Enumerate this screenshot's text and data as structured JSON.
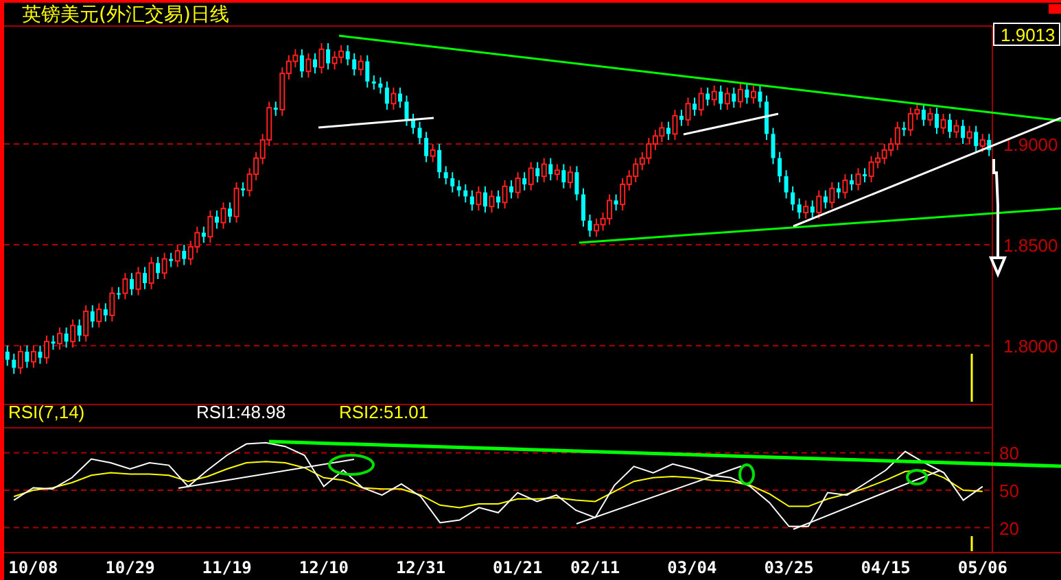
{
  "title": "英镑美元(外汇交易)日线",
  "price_chart": {
    "current": "1.9013",
    "chart_data": {
      "type": "candlestick",
      "grid": true,
      "ylim": [
        1.7708,
        1.9585
      ],
      "categories": [
        null,
        null,
        null,
        null,
        null,
        null,
        null,
        null,
        null,
        null,
        null,
        null,
        null,
        null,
        null,
        null,
        null,
        null,
        null,
        null,
        null,
        null,
        null,
        null,
        null,
        null,
        null,
        null,
        null,
        null,
        null,
        null,
        null,
        null,
        null,
        null,
        null,
        null,
        null,
        null,
        null,
        null,
        null,
        null,
        null,
        null,
        null,
        null,
        null,
        null,
        null,
        null,
        null,
        null,
        null,
        null,
        null,
        null,
        null,
        null,
        null,
        null,
        null,
        null,
        null,
        null,
        null,
        null,
        null,
        null,
        null,
        null,
        null,
        null,
        null,
        null,
        null,
        null,
        null,
        null,
        null,
        null,
        null,
        null,
        null,
        null,
        null,
        null,
        null,
        null,
        null,
        null,
        null,
        null,
        null,
        null,
        null,
        null,
        null,
        null,
        null,
        null,
        null,
        null,
        null,
        null,
        null,
        null,
        null,
        null,
        null,
        null,
        null,
        null,
        null,
        null,
        null,
        null,
        null,
        null,
        null,
        null,
        null,
        null,
        null,
        null,
        null,
        null,
        null,
        null,
        null,
        null,
        null,
        null,
        null,
        null,
        null,
        null,
        null,
        null,
        null,
        null,
        null,
        null,
        null,
        null,
        null,
        null,
        null,
        null,
        null
      ],
      "yticks": [
        {
          "value": 1.9,
          "label": "1.9000"
        },
        {
          "value": 1.85,
          "label": "1.8500"
        },
        {
          "value": 1.8,
          "label": "1.8000"
        }
      ],
      "ohlc": [
        [
          1.797,
          1.8,
          1.79,
          1.793
        ],
        [
          1.793,
          1.796,
          1.786,
          1.789
        ],
        [
          1.789,
          1.8,
          1.786,
          1.797
        ],
        [
          1.797,
          1.8,
          1.789,
          1.792
        ],
        [
          1.792,
          1.8,
          1.789,
          1.797
        ],
        [
          1.797,
          1.8,
          1.791,
          1.794
        ],
        [
          1.794,
          1.805,
          1.791,
          1.802
        ],
        [
          1.802,
          1.805,
          1.798,
          1.801
        ],
        [
          1.801,
          1.809,
          1.798,
          1.806
        ],
        [
          1.806,
          1.809,
          1.799,
          1.802
        ],
        [
          1.802,
          1.813,
          1.799,
          1.81
        ],
        [
          1.81,
          1.813,
          1.802,
          1.805
        ],
        [
          1.805,
          1.82,
          1.802,
          1.817
        ],
        [
          1.817,
          1.82,
          1.809,
          1.812
        ],
        [
          1.812,
          1.821,
          1.809,
          1.818
        ],
        [
          1.818,
          1.821,
          1.812,
          1.815
        ],
        [
          1.815,
          1.829,
          1.812,
          1.826
        ],
        [
          1.826,
          1.829,
          1.823,
          1.826
        ],
        [
          1.826,
          1.836,
          1.823,
          1.833
        ],
        [
          1.833,
          1.836,
          1.825,
          1.828
        ],
        [
          1.828,
          1.839,
          1.825,
          1.836
        ],
        [
          1.836,
          1.839,
          1.828,
          1.831
        ],
        [
          1.831,
          1.844,
          1.828,
          1.841
        ],
        [
          1.841,
          1.844,
          1.833,
          1.836
        ],
        [
          1.836,
          1.846,
          1.833,
          1.843
        ],
        [
          1.843,
          1.846,
          1.839,
          1.842
        ],
        [
          1.842,
          1.85,
          1.839,
          1.847
        ],
        [
          1.847,
          1.85,
          1.84,
          1.843
        ],
        [
          1.843,
          1.852,
          1.84,
          1.849
        ],
        [
          1.849,
          1.859,
          1.846,
          1.856
        ],
        [
          1.856,
          1.859,
          1.851,
          1.854
        ],
        [
          1.854,
          1.867,
          1.851,
          1.864
        ],
        [
          1.864,
          1.867,
          1.858,
          1.861
        ],
        [
          1.861,
          1.871,
          1.858,
          1.868
        ],
        [
          1.868,
          1.871,
          1.861,
          1.864
        ],
        [
          1.864,
          1.881,
          1.861,
          1.878
        ],
        [
          1.878,
          1.881,
          1.874,
          1.877
        ],
        [
          1.877,
          1.888,
          1.874,
          1.885
        ],
        [
          1.885,
          1.896,
          1.882,
          1.893
        ],
        [
          1.893,
          1.905,
          1.89,
          1.902
        ],
        [
          1.902,
          1.921,
          1.899,
          1.918
        ],
        [
          1.918,
          1.921,
          1.914,
          1.917
        ],
        [
          1.917,
          1.938,
          1.914,
          1.935
        ],
        [
          1.935,
          1.944,
          1.932,
          1.941
        ],
        [
          1.941,
          1.947,
          1.938,
          1.944
        ],
        [
          1.944,
          1.947,
          1.933,
          1.936
        ],
        [
          1.936,
          1.945,
          1.933,
          1.942
        ],
        [
          1.942,
          1.945,
          1.935,
          1.938
        ],
        [
          1.938,
          1.95,
          1.935,
          1.947
        ],
        [
          1.947,
          1.95,
          1.937,
          1.94
        ],
        [
          1.94,
          1.946,
          1.937,
          1.943
        ],
        [
          1.943,
          1.949,
          1.94,
          1.946
        ],
        [
          1.946,
          1.949,
          1.939,
          1.942
        ],
        [
          1.942,
          1.945,
          1.934,
          1.937
        ],
        [
          1.937,
          1.944,
          1.934,
          1.941
        ],
        [
          1.941,
          1.944,
          1.928,
          1.931
        ],
        [
          1.931,
          1.934,
          1.927,
          1.93
        ],
        [
          1.93,
          1.933,
          1.925,
          1.928
        ],
        [
          1.928,
          1.931,
          1.917,
          1.92
        ],
        [
          1.92,
          1.928,
          1.917,
          1.925
        ],
        [
          1.925,
          1.928,
          1.918,
          1.921
        ],
        [
          1.921,
          1.924,
          1.909,
          1.912
        ],
        [
          1.912,
          1.915,
          1.905,
          1.908
        ],
        [
          1.908,
          1.911,
          1.9,
          1.903
        ],
        [
          1.903,
          1.906,
          1.891,
          1.894
        ],
        [
          1.894,
          1.9,
          1.891,
          1.897
        ],
        [
          1.897,
          1.9,
          1.883,
          1.886
        ],
        [
          1.886,
          1.889,
          1.88,
          1.883
        ],
        [
          1.883,
          1.886,
          1.876,
          1.879
        ],
        [
          1.879,
          1.882,
          1.874,
          1.877
        ],
        [
          1.877,
          1.88,
          1.871,
          1.874
        ],
        [
          1.874,
          1.877,
          1.867,
          1.87
        ],
        [
          1.87,
          1.879,
          1.867,
          1.876
        ],
        [
          1.876,
          1.879,
          1.866,
          1.869
        ],
        [
          1.869,
          1.877,
          1.866,
          1.874
        ],
        [
          1.874,
          1.877,
          1.868,
          1.871
        ],
        [
          1.871,
          1.882,
          1.868,
          1.879
        ],
        [
          1.879,
          1.882,
          1.873,
          1.876
        ],
        [
          1.876,
          1.886,
          1.873,
          1.883
        ],
        [
          1.883,
          1.886,
          1.877,
          1.88
        ],
        [
          1.88,
          1.891,
          1.877,
          1.888
        ],
        [
          1.888,
          1.891,
          1.881,
          1.884
        ],
        [
          1.884,
          1.893,
          1.881,
          1.89
        ],
        [
          1.89,
          1.893,
          1.882,
          1.885
        ],
        [
          1.885,
          1.89,
          1.882,
          1.887
        ],
        [
          1.887,
          1.89,
          1.878,
          1.881
        ],
        [
          1.881,
          1.889,
          1.878,
          1.886
        ],
        [
          1.886,
          1.889,
          1.872,
          1.875
        ],
        [
          1.875,
          1.878,
          1.859,
          1.862
        ],
        [
          1.862,
          1.865,
          1.854,
          1.857
        ],
        [
          1.857,
          1.863,
          1.854,
          1.86
        ],
        [
          1.86,
          1.866,
          1.857,
          1.863
        ],
        [
          1.863,
          1.875,
          1.86,
          1.872
        ],
        [
          1.872,
          1.875,
          1.867,
          1.87
        ],
        [
          1.87,
          1.883,
          1.867,
          1.88
        ],
        [
          1.88,
          1.887,
          1.877,
          1.884
        ],
        [
          1.884,
          1.893,
          1.881,
          1.89
        ],
        [
          1.89,
          1.896,
          1.887,
          1.893
        ],
        [
          1.893,
          1.903,
          1.89,
          1.9
        ],
        [
          1.9,
          1.907,
          1.897,
          1.904
        ],
        [
          1.904,
          1.911,
          1.901,
          1.908
        ],
        [
          1.908,
          1.911,
          1.902,
          1.905
        ],
        [
          1.905,
          1.917,
          1.902,
          1.914
        ],
        [
          1.914,
          1.917,
          1.909,
          1.912
        ],
        [
          1.912,
          1.923,
          1.909,
          1.92
        ],
        [
          1.92,
          1.923,
          1.914,
          1.917
        ],
        [
          1.917,
          1.928,
          1.914,
          1.925
        ],
        [
          1.925,
          1.928,
          1.919,
          1.922
        ],
        [
          1.922,
          1.929,
          1.919,
          1.926
        ],
        [
          1.926,
          1.929,
          1.917,
          1.92
        ],
        [
          1.92,
          1.928,
          1.917,
          1.925
        ],
        [
          1.925,
          1.928,
          1.918,
          1.921
        ],
        [
          1.921,
          1.93,
          1.918,
          1.927
        ],
        [
          1.927,
          1.93,
          1.92,
          1.923
        ],
        [
          1.923,
          1.929,
          1.92,
          1.926
        ],
        [
          1.926,
          1.929,
          1.918,
          1.921
        ],
        [
          1.921,
          1.924,
          1.902,
          1.905
        ],
        [
          1.905,
          1.908,
          1.89,
          1.893
        ],
        [
          1.893,
          1.896,
          1.881,
          1.884
        ],
        [
          1.884,
          1.887,
          1.873,
          1.876
        ],
        [
          1.876,
          1.879,
          1.867,
          1.87
        ],
        [
          1.87,
          1.873,
          1.863,
          1.866
        ],
        [
          1.866,
          1.872,
          1.863,
          1.869
        ],
        [
          1.869,
          1.872,
          1.863,
          1.866
        ],
        [
          1.866,
          1.877,
          1.863,
          1.874
        ],
        [
          1.874,
          1.877,
          1.868,
          1.871
        ],
        [
          1.871,
          1.881,
          1.868,
          1.878
        ],
        [
          1.878,
          1.881,
          1.873,
          1.876
        ],
        [
          1.876,
          1.885,
          1.873,
          1.882
        ],
        [
          1.882,
          1.885,
          1.877,
          1.88
        ],
        [
          1.88,
          1.888,
          1.877,
          1.885
        ],
        [
          1.885,
          1.888,
          1.881,
          1.884
        ],
        [
          1.884,
          1.894,
          1.881,
          1.891
        ],
        [
          1.891,
          1.896,
          1.888,
          1.893
        ],
        [
          1.893,
          1.9,
          1.89,
          1.897
        ],
        [
          1.897,
          1.903,
          1.894,
          1.9
        ],
        [
          1.9,
          1.911,
          1.897,
          1.908
        ],
        [
          1.908,
          1.911,
          1.904,
          1.907
        ],
        [
          1.907,
          1.918,
          1.904,
          1.915
        ],
        [
          1.915,
          1.92,
          1.912,
          1.917
        ],
        [
          1.917,
          1.92,
          1.909,
          1.912
        ],
        [
          1.912,
          1.918,
          1.909,
          1.915
        ],
        [
          1.915,
          1.918,
          1.905,
          1.908
        ],
        [
          1.908,
          1.915,
          1.905,
          1.912
        ],
        [
          1.912,
          1.915,
          1.903,
          1.906
        ],
        [
          1.906,
          1.912,
          1.903,
          1.909
        ],
        [
          1.909,
          1.912,
          1.9,
          1.903
        ],
        [
          1.903,
          1.909,
          1.9,
          1.906
        ],
        [
          1.906,
          1.909,
          1.896,
          1.899
        ],
        [
          1.899,
          1.905,
          1.896,
          1.902
        ],
        [
          1.902,
          1.905,
          1.894,
          1.897
        ]
      ]
    }
  },
  "indicator": {
    "name": "RSI(7,14)",
    "rsi1": "RSI1:48.98",
    "rsi2": "RSI2:51.01",
    "chart_data": {
      "type": "line",
      "grid": true,
      "ylim": [
        0,
        100
      ],
      "categories": [
        null,
        "10/08",
        null,
        null,
        null,
        null,
        "10/29",
        null,
        null,
        null,
        null,
        "11/19",
        null,
        null,
        null,
        null,
        "12/10",
        null,
        null,
        null,
        null,
        "12/31",
        null,
        null,
        null,
        null,
        "01/21",
        null,
        null,
        null,
        "02/11",
        null,
        null,
        null,
        null,
        "03/04",
        null,
        null,
        null,
        null,
        "03/25",
        null,
        null,
        null,
        null,
        "04/15",
        null,
        null,
        null,
        null,
        "05/06"
      ],
      "series": [
        {
          "color": "#ffffff",
          "values": [
            42,
            52,
            51,
            60,
            75,
            72,
            67,
            72,
            70,
            53,
            66,
            78,
            87,
            88,
            85,
            78,
            53,
            66,
            52,
            46,
            55,
            45,
            24,
            26,
            36,
            32,
            48,
            41,
            46,
            34,
            28,
            54,
            69,
            64,
            71,
            67,
            62,
            60,
            53,
            40,
            21,
            21,
            48,
            46,
            56,
            66,
            81,
            72,
            64,
            42,
            53
          ]
        },
        {
          "color": "#ffff00",
          "values": [
            45,
            50,
            52,
            56,
            62,
            64,
            63,
            63,
            62,
            57,
            61,
            67,
            72,
            73,
            72,
            68,
            60,
            58,
            52,
            51,
            51,
            46,
            38,
            36,
            39,
            39,
            43,
            43,
            44,
            42,
            41,
            49,
            57,
            60,
            61,
            60,
            58,
            57,
            54,
            47,
            37,
            37,
            43,
            47,
            52,
            58,
            65,
            66,
            60,
            50,
            49
          ]
        }
      ],
      "yticks": [
        {
          "value": 80,
          "label": "80"
        },
        {
          "value": 50,
          "label": "50"
        },
        {
          "value": 20,
          "label": "20"
        }
      ]
    }
  }
}
